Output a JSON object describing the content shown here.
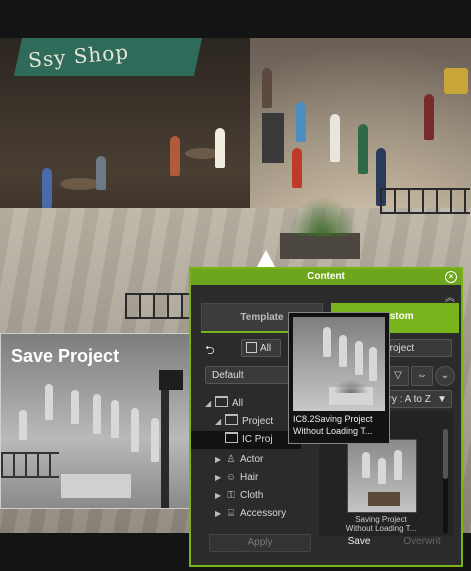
{
  "scene": {
    "sign_text": "Ssy Shop"
  },
  "save_card": {
    "title": "Save Project"
  },
  "panel": {
    "title": "Content",
    "tabs": {
      "template": "Template",
      "custom": "Custom"
    },
    "toolbar": {
      "all_label": "All",
      "project_field": "Project",
      "default_select": "Default",
      "sort_select": "ory : A to Z"
    },
    "tree": [
      {
        "label": "All",
        "expanded": true
      },
      {
        "label": "Project",
        "expanded": true
      },
      {
        "label": "IC Proj",
        "selected": true
      },
      {
        "label": "Actor"
      },
      {
        "label": "Hair"
      },
      {
        "label": "Cloth"
      },
      {
        "label": "Accessory"
      }
    ],
    "thumb_caption": "Saving Project\nWithout Loading T...",
    "buttons": {
      "apply": "Apply",
      "save": "Save",
      "overwrite": "Overwrit"
    }
  },
  "tooltip": {
    "text": "IC8.2Saving Project Without Loading T..."
  },
  "colors": {
    "accent": "#7ab317",
    "panel_bg": "#2b2b2b"
  }
}
